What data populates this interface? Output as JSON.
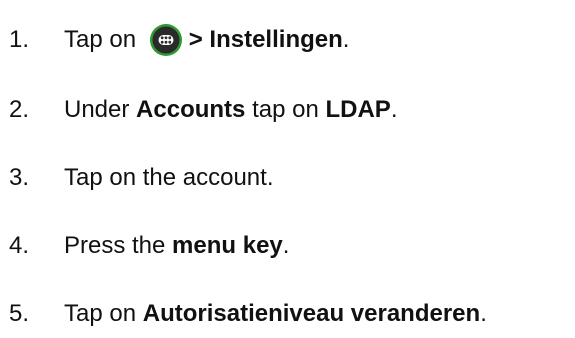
{
  "steps": [
    {
      "number": "1.",
      "text_before": "Tap on ",
      "icon": "app-drawer-icon",
      "bold": "> Instellingen",
      "text_after": "."
    },
    {
      "number": "2.",
      "text_before": "Under ",
      "bold_1": "Accounts",
      "text_middle": " tap on ",
      "bold_2": "LDAP",
      "text_after": "."
    },
    {
      "number": "3.",
      "text": "Tap on the account."
    },
    {
      "number": "4.",
      "text_before": "Press the ",
      "bold": "menu key",
      "text_after": "."
    },
    {
      "number": "5.",
      "text_before": "Tap on ",
      "bold": "Autorisatieniveau veranderen",
      "text_after": "."
    }
  ],
  "colors": {
    "icon_ring": "#2f9a2f",
    "icon_fill": "#2a2a2a",
    "icon_dots": "#ffffff"
  }
}
